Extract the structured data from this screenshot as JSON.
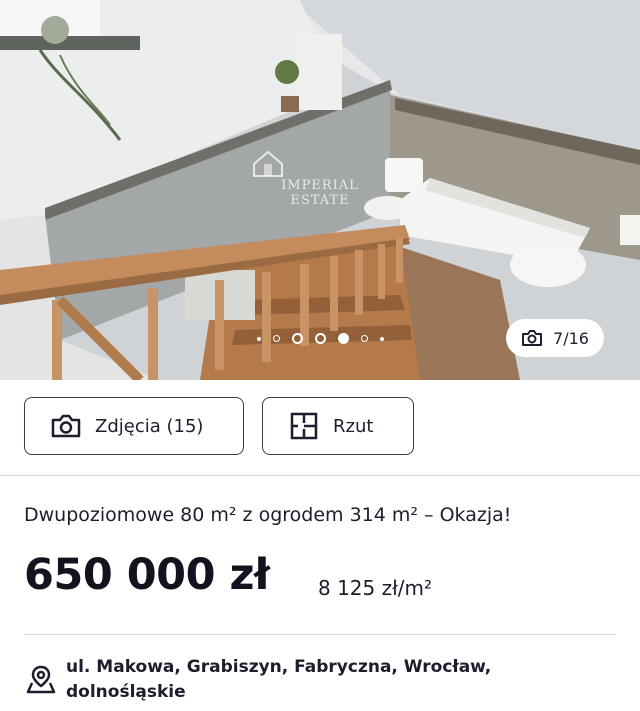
{
  "gallery": {
    "watermark": "IMPERIAL ESTATE",
    "counter": "7/16",
    "icons": {
      "counter": "camera-icon"
    }
  },
  "actions": {
    "photos_label": "Zdjęcia (15)",
    "plan_label": "Rzut",
    "icons": {
      "photos": "camera-icon",
      "plan": "floor-plan-icon"
    }
  },
  "listing": {
    "title": "Dwupoziomowe 80 m² z ogrodem 314 m² – Okazja!",
    "price": "650 000 zł",
    "price_per_m2": "8 125 zł/m²",
    "location": "ul. Makowa, Grabiszyn, Fabryczna, Wrocław, dolnośląskie",
    "location_icon": "map-pin-icon"
  },
  "colors": {
    "text": "#1d1e2c",
    "divider": "#d9dadd",
    "button_border": "#3a3d4a"
  }
}
